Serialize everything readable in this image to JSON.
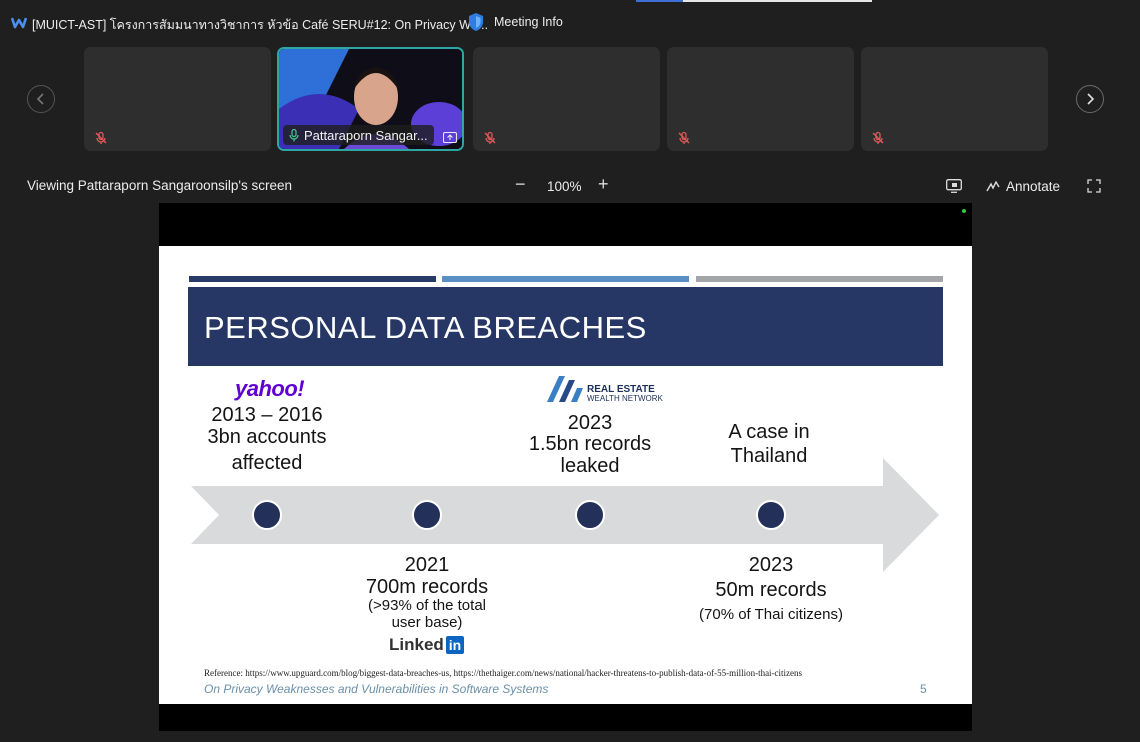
{
  "window": {
    "title": "[MUICT-AST] โครงการสัมมนาทางวิชาการ หัวข้อ Café SERU#12: On Privacy We...",
    "meeting_info_label": "Meeting Info",
    "progress_fraction": 0.2
  },
  "participants": [
    {
      "name": "",
      "muted": true
    },
    {
      "name": "Pattaraporn Sangar...",
      "muted": false,
      "active": true
    },
    {
      "name": "",
      "muted": true
    },
    {
      "name": "",
      "muted": true
    },
    {
      "name": "",
      "muted": true
    }
  ],
  "share_bar": {
    "viewing_label": "Viewing Pattaraporn Sangaroonsilp's screen",
    "zoom_minus": "−",
    "zoom_level": "100%",
    "zoom_plus": "+",
    "annotate_label": "Annotate"
  },
  "slide": {
    "title": "PERSONAL DATA BREACHES",
    "events": [
      {
        "logo": "yahoo!",
        "year": "2013 – 2016",
        "line1": "3bn accounts",
        "line2": "affected"
      },
      {
        "year": "2021",
        "line1": "700m records",
        "note1": "(>93% of the total",
        "note2": "user base)",
        "logo": "Linked",
        "logo_badge": "in"
      },
      {
        "logo_line1": "REAL ESTATE",
        "logo_line2": "WEALTH NETWORK",
        "year": "2023",
        "line1": "1.5bn records",
        "line2": "leaked"
      },
      {
        "line1": "A case in",
        "line2": "Thailand",
        "year": "2023",
        "line3": "50m records",
        "note": "(70% of Thai citizens)"
      }
    ],
    "reference": "Reference: https://www.upguard.com/blog/biggest-data-breaches-us, https://thethaiger.com/news/national/hacker-threatens-to-publish-data-of-55-million-thai-citizens",
    "footer": "On Privacy Weaknesses and Vulnerabilities in Software Systems",
    "page_number": "5"
  },
  "colors": {
    "banner": "#263766",
    "arrow": "#d9dadc",
    "dot": "#22305a",
    "active_tile_border": "#2ea7a2"
  }
}
